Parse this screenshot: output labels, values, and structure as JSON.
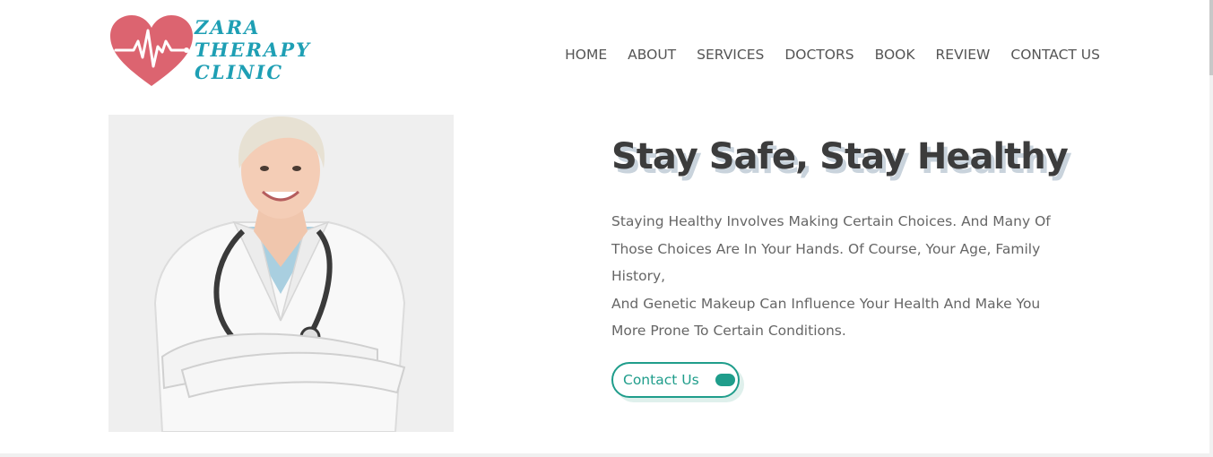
{
  "brand": {
    "lines": [
      "ZARA",
      "THERAPY",
      "CLINIC"
    ],
    "heart_color": "#dc6470",
    "text_color": "#1e9fb4"
  },
  "nav": {
    "items": [
      "HOME",
      "ABOUT",
      "SERVICES",
      "DOCTORS",
      "BOOK",
      "REVIEW",
      "CONTACT US"
    ]
  },
  "hero": {
    "image_icon": "doctor-photo",
    "title": "Stay Safe, Stay Healthy",
    "paragraph_lines": [
      "Staying Healthy Involves Making Certain Choices. And Many Of",
      "Those Choices Are In Your Hands. Of Course, Your Age, Family",
      "History,",
      "And Genetic Makeup Can Influence Your Health And Make You",
      "More Prone To Certain Conditions."
    ],
    "cta_label": "Contact Us",
    "accent": "#1f9d8b"
  }
}
